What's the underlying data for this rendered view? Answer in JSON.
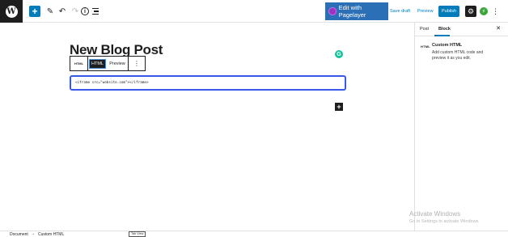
{
  "toolbar": {
    "pagelayer_label": "Edit with Pagelayer",
    "save_draft_label": "Save draft",
    "preview_label": "Preview",
    "publish_label": "Publish"
  },
  "editor": {
    "post_title": "New Blog Post",
    "block_toolbar": {
      "html_icon_label": "HTML",
      "html_tab_label": "HTML",
      "preview_tab_label": "Preview"
    },
    "html_content": "<iframe src=\"website.com\"></iframe>"
  },
  "sidebar": {
    "tabs": [
      {
        "label": "Post",
        "active": false
      },
      {
        "label": "Block",
        "active": true
      }
    ],
    "block_icon_label": "HTML",
    "block_name": "Custom HTML",
    "block_description": "Add custom HTML code and preview it as you edit."
  },
  "watermark": {
    "title": "Activate Windows",
    "subtitle": "Go to Settings to activate Windows."
  },
  "footer": {
    "breadcrumb": [
      "Document",
      "Custom HTML"
    ],
    "separator": "→",
    "tooltip": "Tab View"
  },
  "colors": {
    "accent": "#007cba",
    "block_outline": "#3858e9",
    "pagelayer_button": "#2b6fb6",
    "dark": "#1e1e1e"
  },
  "icons": {
    "logo": "wordpress-logo-icon",
    "add": "plus-icon",
    "edit": "pencil-icon",
    "undo": "undo-icon",
    "redo": "redo-icon",
    "details": "info-icon",
    "list": "list-view-icon",
    "settings": "gear-icon",
    "performance": "bolt-icon",
    "more": "more-vertical-icon",
    "close": "close-icon",
    "grammarly": "grammarly-icon",
    "inserter": "plus-icon"
  }
}
